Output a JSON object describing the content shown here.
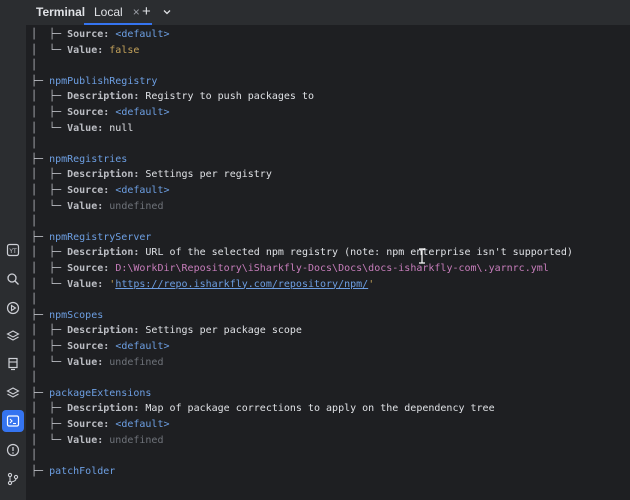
{
  "tabs": {
    "tool_title": "Terminal",
    "local_label": "Local",
    "close_glyph": "×",
    "add_glyph": "+"
  },
  "terminal": {
    "l1_tree": "│  ├─ ",
    "l1_key": "Source:",
    "l1_val": "<default>",
    "l2_tree": "│  └─ ",
    "l2_key": "Value:",
    "l2_val": "false",
    "l3_tree": "│",
    "l4_tree": "├─ ",
    "l4_name": "npmPublishRegistry",
    "l5_tree": "│  ├─ ",
    "l5_key": "Description:",
    "l5_val": "Registry to push packages to",
    "l6_tree": "│  ├─ ",
    "l6_key": "Source:",
    "l6_val": "<default>",
    "l7_tree": "│  └─ ",
    "l7_key": "Value:",
    "l7_val": "null",
    "l8_tree": "│",
    "l9_tree": "├─ ",
    "l9_name": "npmRegistries",
    "l10_tree": "│  ├─ ",
    "l10_key": "Description:",
    "l10_val": "Settings per registry",
    "l11_tree": "│  ├─ ",
    "l11_key": "Source:",
    "l11_val": "<default>",
    "l12_tree": "│  └─ ",
    "l12_key": "Value:",
    "l12_val": "undefined",
    "l13_tree": "│",
    "l14_tree": "├─ ",
    "l14_name": "npmRegistryServer",
    "l15_tree": "│  ├─ ",
    "l15_key": "Description:",
    "l15_val": "URL of the selected npm registry (note: npm enterprise isn't supported)",
    "l16_tree": "│  ├─ ",
    "l16_key": "Source:",
    "l16_val": "D:\\WorkDir\\Repository\\iSharkfly-Docs\\Docs\\docs-isharkfly-com\\.yarnrc.yml",
    "l17_tree": "│  └─ ",
    "l17_key": "Value:",
    "l17_q1": "'",
    "l17_url": "https://repo.isharkfly.com/repository/npm/",
    "l17_q2": "'",
    "l18_tree": "│",
    "l19_tree": "├─ ",
    "l19_name": "npmScopes",
    "l20_tree": "│  ├─ ",
    "l20_key": "Description:",
    "l20_val": "Settings per package scope",
    "l21_tree": "│  ├─ ",
    "l21_key": "Source:",
    "l21_val": "<default>",
    "l22_tree": "│  └─ ",
    "l22_key": "Value:",
    "l22_val": "undefined",
    "l23_tree": "│",
    "l24_tree": "├─ ",
    "l24_name": "packageExtensions",
    "l25_tree": "│  ├─ ",
    "l25_key": "Description:",
    "l25_val": "Map of package corrections to apply on the dependency tree",
    "l26_tree": "│  ├─ ",
    "l26_key": "Source:",
    "l26_val": "<default>",
    "l27_tree": "│  └─ ",
    "l27_key": "Value:",
    "l27_val": "undefined",
    "l28_tree": "│",
    "l29_tree": "├─ ",
    "l29_name": "patchFolder"
  },
  "colors": {
    "background": "#1e1f22",
    "accent": "#3574f0",
    "setting_name": "#6d9fe3",
    "path": "#c77dbb",
    "boolean": "#c4a25a"
  },
  "sidebar_icons": [
    "yaml-icon",
    "search-icon",
    "run-icon",
    "layers-icon",
    "todo-icon",
    "services-icon",
    "terminal-icon",
    "problems-icon",
    "git-icon"
  ]
}
